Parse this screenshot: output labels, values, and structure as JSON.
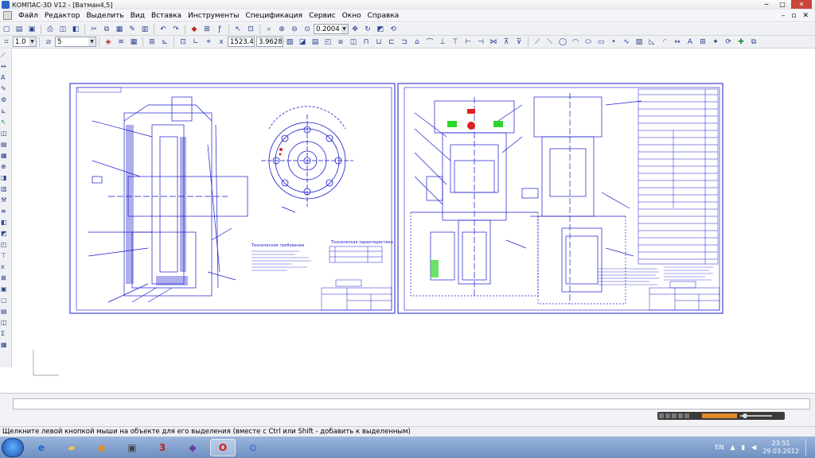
{
  "window": {
    "title": "КОМПАС-3D V12 - [Ватман4,5]"
  },
  "menu": {
    "items": [
      "Файл",
      "Редактор",
      "Выделить",
      "Вид",
      "Вставка",
      "Инструменты",
      "Спецификация",
      "Сервис",
      "Окно",
      "Справка"
    ]
  },
  "toolbar1": {
    "zoom_value": "0.2004"
  },
  "toolbar2": {
    "scale_value": "1.0",
    "layer_value": "5",
    "x_coord": "1523.4",
    "y_coord": "3.9628"
  },
  "status": {
    "hint": "Щелкните левой кнопкой мыши на объекте для его выделения (вместе с Ctrl или Shift - добавить к выделенным)"
  },
  "sheet_left": {
    "title": "Технические требования",
    "table_title": "Техническая характеристика"
  },
  "taskbar": {
    "language": "EN",
    "time": "23:51",
    "date": "29.03.2012"
  },
  "colors": {
    "drawing": "#1a1acc",
    "selection": "#2bd62b",
    "highlight": "#e02020",
    "taskbar": "#6e8fc0"
  }
}
